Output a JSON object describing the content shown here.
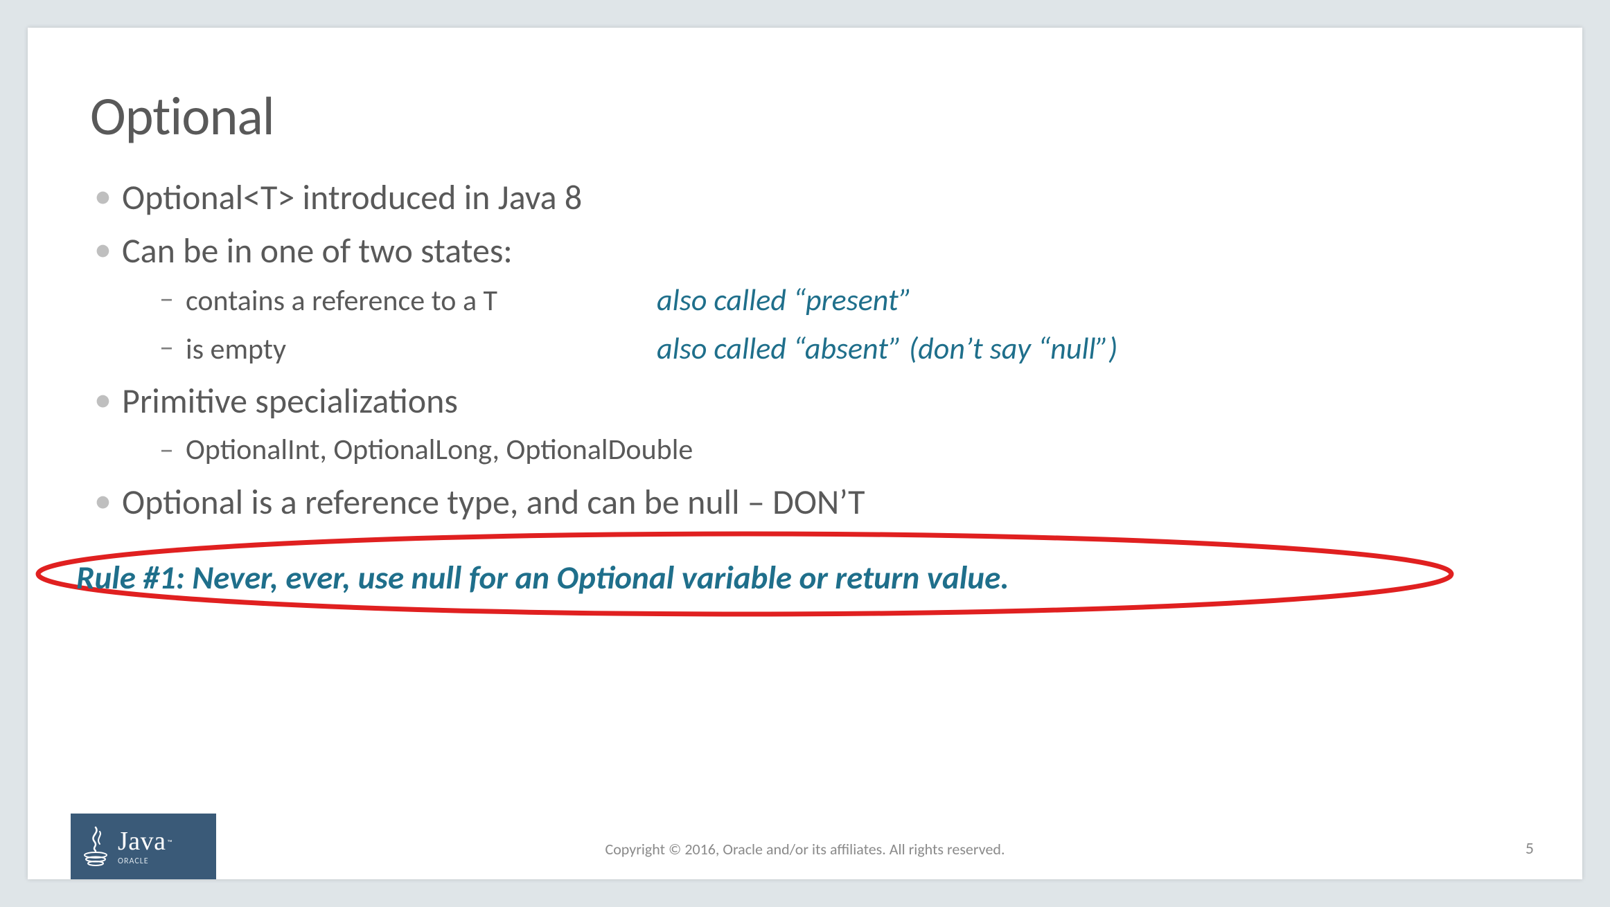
{
  "title": "Optional",
  "bullets": {
    "b1": "Optional<T> introduced in Java 8",
    "b2": "Can be in one of two states:",
    "b2_sub1_lead": "contains a reference to a T",
    "b2_sub1_note": "also called “present”",
    "b2_sub2_lead": "is empty",
    "b2_sub2_note": "also called “absent” (don’t say “null”)",
    "b3": "Primitive specializations",
    "b3_sub1": "OptionalInt, OptionalLong, OptionalDouble",
    "b4": "Optional is a reference type, and can be null – DON’T"
  },
  "rule": "Rule #1: Never, ever, use null for an Optional variable or return value.",
  "footer": {
    "logo_name": "Java",
    "logo_sub": "ORACLE",
    "copyright": "Copyright © 2016, Oracle and/or its affiliates. All rights reserved.",
    "page": "5"
  },
  "colors": {
    "accent": "#1f6f8b",
    "annotation": "#e02020",
    "badge": "#3a5a78"
  }
}
